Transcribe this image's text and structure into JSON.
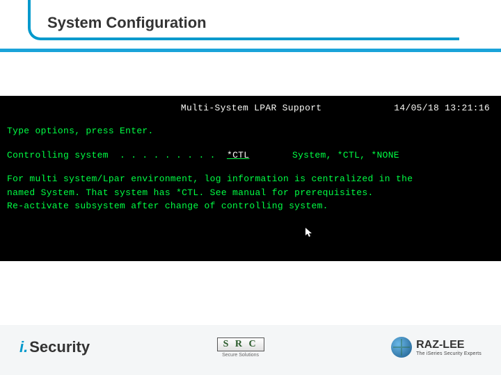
{
  "slide": {
    "title": "System Configuration"
  },
  "terminal": {
    "screen_title": "Multi-System LPAR Support",
    "datetime": "14/05/18 13:21:16",
    "instruction": "Type options, press Enter.",
    "field": {
      "label": "Controlling system",
      "dots": "  . . . . . . . . .  ",
      "value": "*CTL",
      "hint": "System, *CTL, *NONE"
    },
    "description": "For multi system/Lpar environment, log information is centralized in the\nnamed System. That system has *CTL. See manual for prerequisites.\nRe-activate subsystem after change of controlling system."
  },
  "footer": {
    "logo1_i": "i.",
    "logo1_sec": "Security",
    "logo2_text": "S R C",
    "logo2_tag": "Secure Solutions",
    "logo3_name": "RAZ-LEE",
    "logo3_sub": "The iSeries Security Experts"
  }
}
